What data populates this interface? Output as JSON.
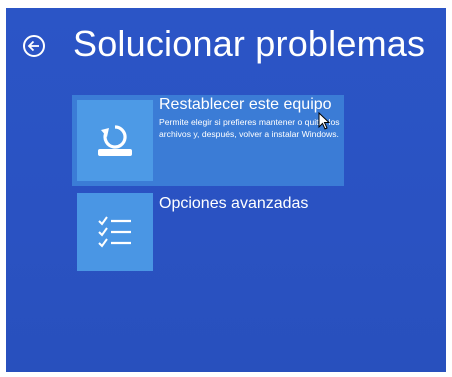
{
  "header": {
    "title": "Solucionar problemas",
    "back_icon": "back-arrow-circle-icon"
  },
  "options": [
    {
      "title": "Restablecer este equipo",
      "description": "Permite elegir si prefieres mantener o quitar los archivos y, después, volver a instalar Windows.",
      "icon": "reset-pc-icon",
      "selected": true
    },
    {
      "title": "Opciones avanzadas",
      "description": "",
      "icon": "checklist-icon",
      "selected": false
    }
  ],
  "colors": {
    "background": "#2b55c6",
    "selected_option": "#3b7cd6",
    "tile": "#4a96e4",
    "text": "#ffffff"
  },
  "pointer_icon": "mouse-pointer-icon"
}
